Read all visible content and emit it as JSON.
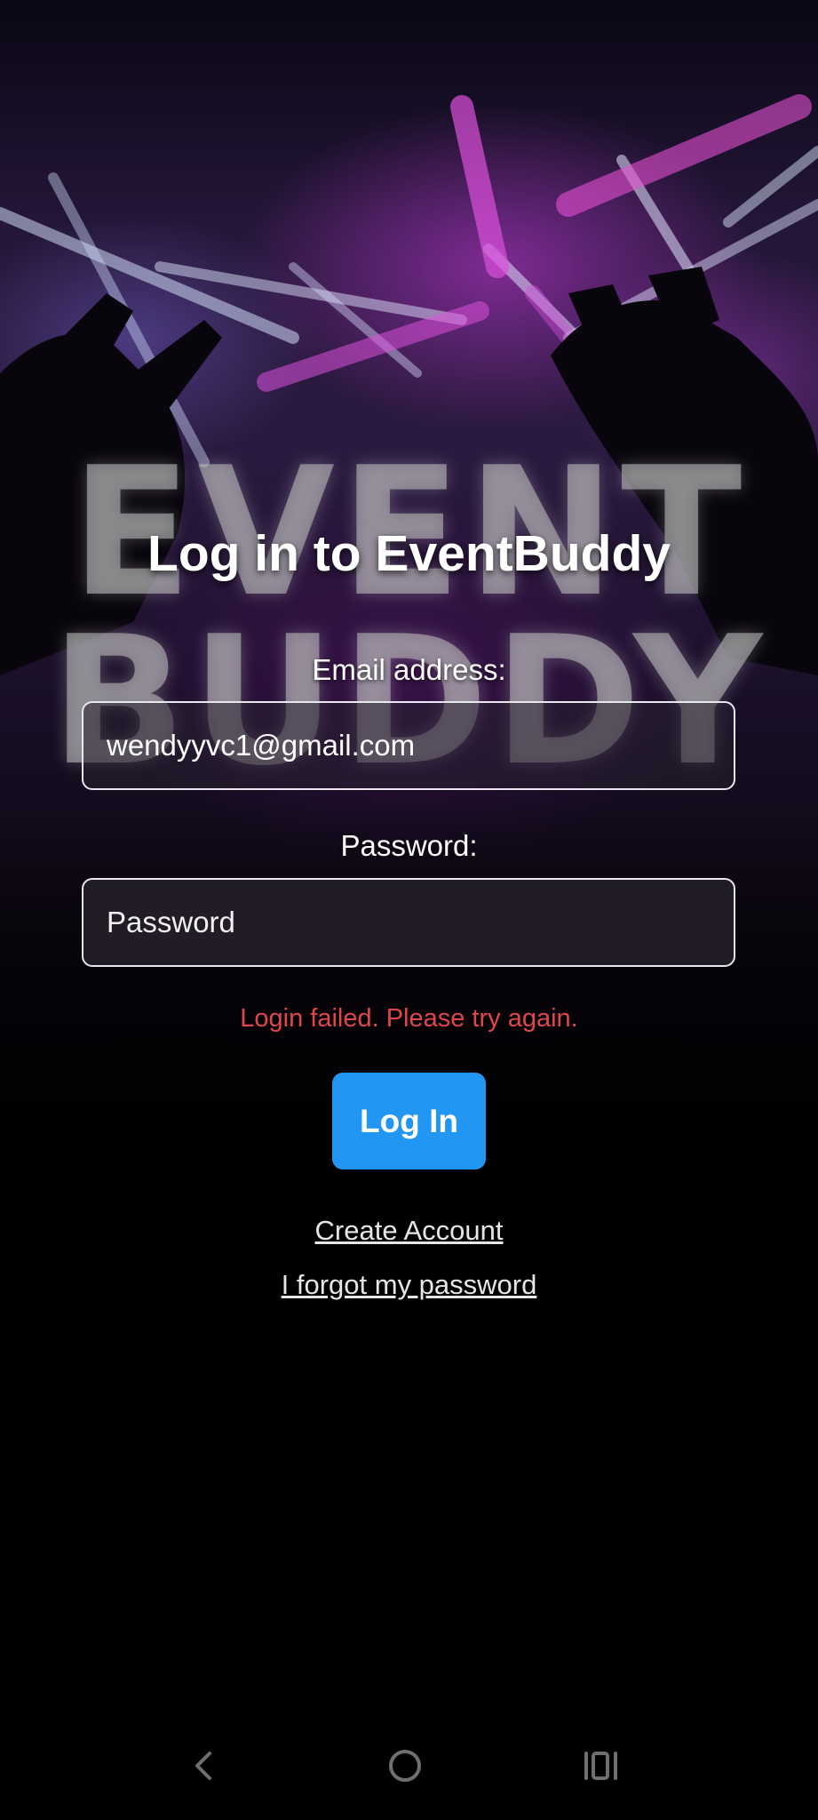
{
  "background": {
    "watermark_line1": "EVENT",
    "watermark_line2": "BUDDY"
  },
  "login": {
    "title": "Log in to EventBuddy",
    "email_label": "Email address:",
    "email_value": "wendyyvc1@gmail.com",
    "password_label": "Password:",
    "password_placeholder": "Password",
    "error_message": "Login failed. Please try again.",
    "login_button": "Log In",
    "create_account_link": "Create Account",
    "forgot_password_link": "I forgot my password"
  },
  "nav_bar": {
    "back_icon": "chevron-left-icon",
    "home_icon": "circle-home-icon",
    "recents_icon": "recents-icon"
  },
  "colors": {
    "primary_button": "#2196f3",
    "error_text": "#e0464a",
    "background": "#000000"
  }
}
